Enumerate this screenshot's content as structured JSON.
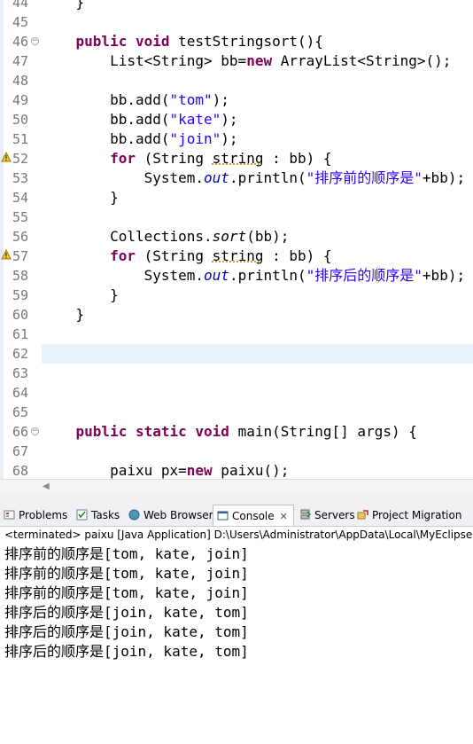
{
  "editor": {
    "lines": [
      {
        "n": "44",
        "segs": [
          {
            "t": "    }",
            "c": ""
          }
        ]
      },
      {
        "n": "45",
        "segs": []
      },
      {
        "n": "46",
        "fold": true,
        "segs": [
          {
            "t": "    ",
            "c": ""
          },
          {
            "t": "public",
            "c": "kw"
          },
          {
            "t": " ",
            "c": ""
          },
          {
            "t": "void",
            "c": "kw"
          },
          {
            "t": " testStringsort(){",
            "c": ""
          }
        ]
      },
      {
        "n": "47",
        "segs": [
          {
            "t": "        List<String> bb=",
            "c": ""
          },
          {
            "t": "new",
            "c": "kw"
          },
          {
            "t": " ArrayList<String>();",
            "c": ""
          }
        ]
      },
      {
        "n": "48",
        "segs": []
      },
      {
        "n": "49",
        "segs": [
          {
            "t": "        bb.add(",
            "c": ""
          },
          {
            "t": "\"tom\"",
            "c": "str"
          },
          {
            "t": ");",
            "c": ""
          }
        ]
      },
      {
        "n": "50",
        "segs": [
          {
            "t": "        bb.add(",
            "c": ""
          },
          {
            "t": "\"kate\"",
            "c": "str"
          },
          {
            "t": ");",
            "c": ""
          }
        ]
      },
      {
        "n": "51",
        "segs": [
          {
            "t": "        bb.add(",
            "c": ""
          },
          {
            "t": "\"join\"",
            "c": "str"
          },
          {
            "t": ");",
            "c": ""
          }
        ]
      },
      {
        "n": "52",
        "warn": true,
        "segs": [
          {
            "t": "        ",
            "c": ""
          },
          {
            "t": "for",
            "c": "kw"
          },
          {
            "t": " (String ",
            "c": ""
          },
          {
            "t": "string",
            "c": "warnword"
          },
          {
            "t": " : bb) {",
            "c": ""
          }
        ]
      },
      {
        "n": "53",
        "segs": [
          {
            "t": "            System.",
            "c": ""
          },
          {
            "t": "out",
            "c": "fld"
          },
          {
            "t": ".println(",
            "c": ""
          },
          {
            "t": "\"排序前的顺序是\"",
            "c": "str"
          },
          {
            "t": "+bb);",
            "c": ""
          }
        ]
      },
      {
        "n": "54",
        "segs": [
          {
            "t": "        }",
            "c": ""
          }
        ]
      },
      {
        "n": "55",
        "segs": []
      },
      {
        "n": "56",
        "segs": [
          {
            "t": "        Collections.",
            "c": ""
          },
          {
            "t": "sort",
            "c": "ital"
          },
          {
            "t": "(bb);",
            "c": ""
          }
        ]
      },
      {
        "n": "57",
        "warn": true,
        "segs": [
          {
            "t": "        ",
            "c": ""
          },
          {
            "t": "for",
            "c": "kw"
          },
          {
            "t": " (String ",
            "c": ""
          },
          {
            "t": "string",
            "c": "warnword"
          },
          {
            "t": " : bb) {",
            "c": ""
          }
        ]
      },
      {
        "n": "58",
        "segs": [
          {
            "t": "            System.",
            "c": ""
          },
          {
            "t": "out",
            "c": "fld"
          },
          {
            "t": ".println(",
            "c": ""
          },
          {
            "t": "\"排序后的顺序是\"",
            "c": "str"
          },
          {
            "t": "+bb);",
            "c": ""
          }
        ]
      },
      {
        "n": "59",
        "segs": [
          {
            "t": "        }",
            "c": ""
          }
        ]
      },
      {
        "n": "60",
        "segs": [
          {
            "t": "    }",
            "c": ""
          }
        ]
      },
      {
        "n": "61",
        "segs": []
      },
      {
        "n": "62",
        "current": true,
        "segs": []
      },
      {
        "n": "63",
        "segs": []
      },
      {
        "n": "64",
        "segs": []
      },
      {
        "n": "65",
        "segs": []
      },
      {
        "n": "66",
        "fold": true,
        "segs": [
          {
            "t": "    ",
            "c": ""
          },
          {
            "t": "public",
            "c": "kw"
          },
          {
            "t": " ",
            "c": ""
          },
          {
            "t": "static",
            "c": "kw"
          },
          {
            "t": " ",
            "c": ""
          },
          {
            "t": "void",
            "c": "kw"
          },
          {
            "t": " main(String[] args) {",
            "c": ""
          }
        ]
      },
      {
        "n": "67",
        "segs": []
      },
      {
        "n": "68",
        "segs": [
          {
            "t": "        paixu px=",
            "c": ""
          },
          {
            "t": "new",
            "c": "kw"
          },
          {
            "t": " paixu();",
            "c": ""
          }
        ]
      }
    ]
  },
  "tabs": [
    {
      "id": "problems",
      "label": "Problems",
      "icon": "problems-icon"
    },
    {
      "id": "tasks",
      "label": "Tasks",
      "icon": "tasks-icon"
    },
    {
      "id": "web-browser",
      "label": "Web Browser",
      "icon": "globe-icon"
    },
    {
      "id": "console",
      "label": "Console",
      "icon": "console-icon",
      "active": true,
      "close": "✕"
    },
    {
      "id": "servers",
      "label": "Servers",
      "icon": "servers-icon"
    },
    {
      "id": "project-migration",
      "label": "Project Migration",
      "icon": "migration-icon"
    }
  ],
  "console": {
    "status": "<terminated> paixu [Java Application] D:\\Users\\Administrator\\AppData\\Local\\MyEclipse Pro",
    "output": [
      "排序前的顺序是[tom, kate, join]",
      "排序前的顺序是[tom, kate, join]",
      "排序前的顺序是[tom, kate, join]",
      "排序后的顺序是[join, kate, tom]",
      "排序后的顺序是[join, kate, tom]",
      "排序后的顺序是[join, kate, tom]"
    ]
  },
  "colors": {
    "keyword": "#7f0055",
    "string": "#2a00ff",
    "field": "#0000c0",
    "current_line": "#e8f2fe"
  }
}
